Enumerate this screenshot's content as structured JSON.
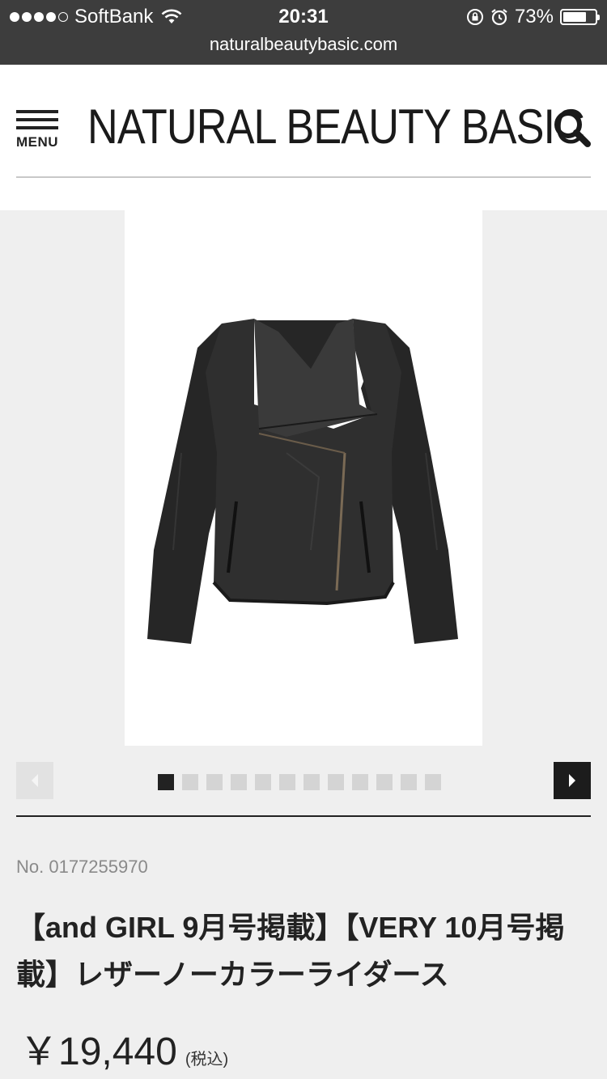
{
  "status_bar": {
    "carrier": "SoftBank",
    "time": "20:31",
    "battery": "73%",
    "battery_level": 0.73,
    "url": "naturalbeautybasic.com"
  },
  "header": {
    "menu_label": "MENU",
    "logo_text": "NATURAL BEAUTY BASIC",
    "icons": {
      "menu": "hamburger-menu-icon",
      "search": "search-icon"
    }
  },
  "gallery": {
    "image_alt": "black leather collarless riders jacket",
    "page_count": 12,
    "active_page": 1,
    "icons": {
      "prev": "chevron-left-icon",
      "next": "chevron-right-icon"
    },
    "colors": {
      "active_dot": "#222222",
      "inactive_dot": "#d4d4d4",
      "next_button": "#1c1c1c",
      "prev_button": "#e2e2e2"
    }
  },
  "product": {
    "number": "No. 0177255970",
    "title": "【and GIRL 9月号掲載】【VERY 10月号掲載】レザーノーカラーライダース",
    "price": "￥19,440",
    "tax_note": "(税込)"
  }
}
